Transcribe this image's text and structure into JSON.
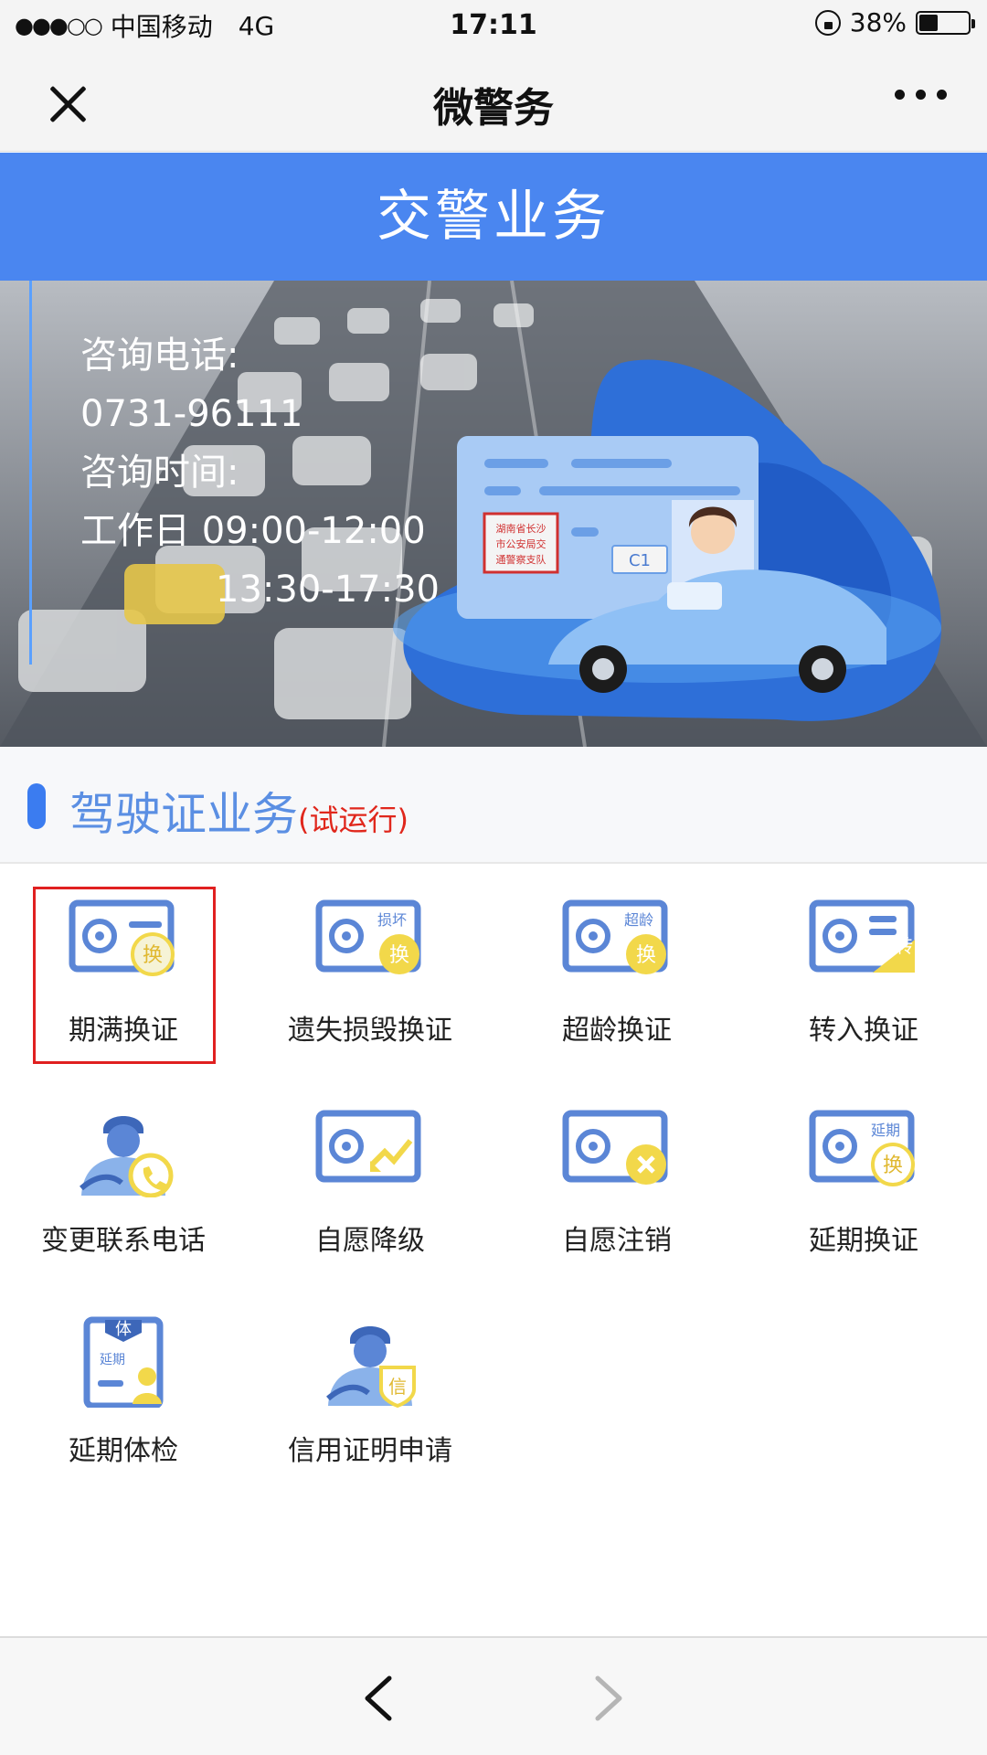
{
  "status_bar": {
    "signal": "●●●○○",
    "carrier": "中国移动",
    "network": "4G",
    "time": "17:11",
    "battery": "38%",
    "battery_level": 0.38
  },
  "nav": {
    "title": "微警务"
  },
  "header": {
    "title": "交警业务"
  },
  "banner": {
    "phone_label": "咨询电话:",
    "phone": "0731-96111",
    "hours_label": "咨询时间:",
    "hours_line1": "工作日 09:00-12:00",
    "hours_line2": "13:30-17:30",
    "card_issuer_line1": "湖南省长沙",
    "card_issuer_line2": "市公安局交",
    "card_issuer_line3": "通警察支队",
    "card_class": "C1"
  },
  "section": {
    "title": "驾驶证业务",
    "subtitle": "(试运行)"
  },
  "services": [
    {
      "label": "期满换证",
      "badge": "换",
      "tag": ""
    },
    {
      "label": "遗失损毁换证",
      "badge": "换",
      "tag": "损坏"
    },
    {
      "label": "超龄换证",
      "badge": "换",
      "tag": "超龄"
    },
    {
      "label": "转入换证",
      "badge": "转",
      "tag": ""
    },
    {
      "label": "变更联系电话",
      "badge": "",
      "tag": ""
    },
    {
      "label": "自愿降级",
      "badge": "",
      "tag": ""
    },
    {
      "label": "自愿注销",
      "badge": "",
      "tag": ""
    },
    {
      "label": "延期换证",
      "badge": "换",
      "tag": "延期"
    },
    {
      "label": "延期体检",
      "badge": "体",
      "tag": "延期"
    },
    {
      "label": "信用证明申请",
      "badge": "信",
      "tag": ""
    }
  ],
  "colors": {
    "primary_blue": "#4a86f0",
    "icon_blue": "#5b86d6",
    "icon_yellow": "#f2d84a",
    "highlight_red": "#e02020",
    "subtitle_red": "#e0271c"
  },
  "icons": {
    "close": "close-icon",
    "more": "more-icon",
    "back": "chevron-left-icon",
    "forward": "chevron-right-icon"
  }
}
